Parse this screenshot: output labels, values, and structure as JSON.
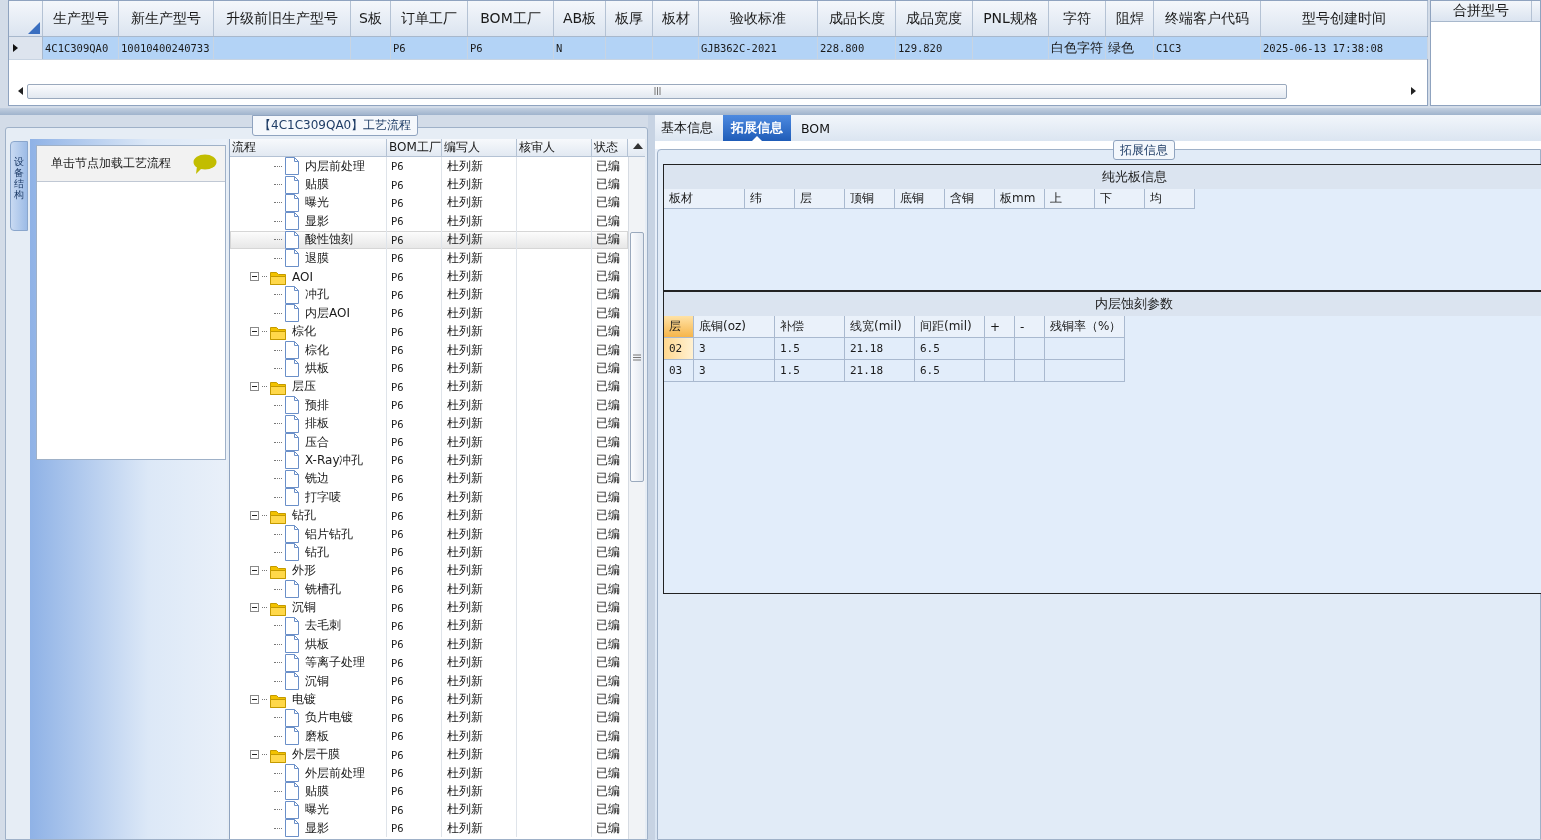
{
  "grid": {
    "columns": [
      "生产型号",
      "新生产型号",
      "升级前旧生产型号",
      "S板",
      "订单工厂",
      "BOM工厂",
      "AB板",
      "板厚",
      "板材",
      "验收标准",
      "成品长度",
      "成品宽度",
      "PNL规格",
      "字符",
      "阻焊",
      "终端客户代码",
      "型号创建时间"
    ],
    "rows": [
      {
        "selected": true,
        "cells": [
          "4C1C309QA0",
          "10010400240733",
          null,
          null,
          "P6",
          "P6",
          "N",
          null,
          null,
          "GJB362C-2021",
          "228.800",
          "129.820",
          null,
          "白色字符",
          "绿色",
          "C1C3",
          "2025-06-13 17:38:08"
        ]
      }
    ]
  },
  "merge_panel": {
    "title": "合拼型号"
  },
  "process": {
    "title": "【4C1C309QA0】工艺流程",
    "side_tab": "设备结构",
    "hint": "单击节点加载工艺流程",
    "columns": [
      "流程",
      "BOM工厂",
      "编写人",
      "核审人",
      "状态"
    ],
    "nodes": [
      {
        "kind": "doc",
        "label": "内层前处理",
        "bom": "P6",
        "writer": "杜列新",
        "status": "已编",
        "selected": false
      },
      {
        "kind": "doc",
        "label": "贴膜",
        "bom": "P6",
        "writer": "杜列新",
        "status": "已编",
        "selected": false
      },
      {
        "kind": "doc",
        "label": "曝光",
        "bom": "P6",
        "writer": "杜列新",
        "status": "已编",
        "selected": false
      },
      {
        "kind": "doc",
        "label": "显影",
        "bom": "P6",
        "writer": "杜列新",
        "status": "已编",
        "selected": false
      },
      {
        "kind": "doc",
        "label": "酸性蚀刻",
        "bom": "P6",
        "writer": "杜列新",
        "status": "已编",
        "selected": true
      },
      {
        "kind": "doc",
        "label": "退膜",
        "bom": "P6",
        "writer": "杜列新",
        "status": "已编",
        "selected": false
      },
      {
        "kind": "folder",
        "label": "AOI",
        "bom": "P6",
        "writer": "杜列新",
        "status": "已编",
        "selected": false,
        "expanded": true,
        "children": [
          {
            "kind": "doc",
            "label": "冲孔",
            "bom": "P6",
            "writer": "杜列新",
            "status": "已编",
            "selected": false
          },
          {
            "kind": "doc",
            "label": "内层AOI",
            "bom": "P6",
            "writer": "杜列新",
            "status": "已编",
            "selected": false
          }
        ]
      },
      {
        "kind": "folder",
        "label": "棕化",
        "bom": "P6",
        "writer": "杜列新",
        "status": "已编",
        "selected": false,
        "expanded": true,
        "children": [
          {
            "kind": "doc",
            "label": "棕化",
            "bom": "P6",
            "writer": "杜列新",
            "status": "已编",
            "selected": false
          },
          {
            "kind": "doc",
            "label": "烘板",
            "bom": "P6",
            "writer": "杜列新",
            "status": "已编",
            "selected": false
          }
        ]
      },
      {
        "kind": "folder",
        "label": "层压",
        "bom": "P6",
        "writer": "杜列新",
        "status": "已编",
        "selected": false,
        "expanded": true,
        "children": [
          {
            "kind": "doc",
            "label": "预排",
            "bom": "P6",
            "writer": "杜列新",
            "status": "已编",
            "selected": false
          },
          {
            "kind": "doc",
            "label": "排板",
            "bom": "P6",
            "writer": "杜列新",
            "status": "已编",
            "selected": false
          },
          {
            "kind": "doc",
            "label": "压合",
            "bom": "P6",
            "writer": "杜列新",
            "status": "已编",
            "selected": false
          },
          {
            "kind": "doc",
            "label": "X-Ray冲孔",
            "bom": "P6",
            "writer": "杜列新",
            "status": "已编",
            "selected": false
          },
          {
            "kind": "doc",
            "label": "铣边",
            "bom": "P6",
            "writer": "杜列新",
            "status": "已编",
            "selected": false
          },
          {
            "kind": "doc",
            "label": "打字唛",
            "bom": "P6",
            "writer": "杜列新",
            "status": "已编",
            "selected": false
          }
        ]
      },
      {
        "kind": "folder",
        "label": "钻孔",
        "bom": "P6",
        "writer": "杜列新",
        "status": "已编",
        "selected": false,
        "expanded": true,
        "children": [
          {
            "kind": "doc",
            "label": "铝片钻孔",
            "bom": "P6",
            "writer": "杜列新",
            "status": "已编",
            "selected": false
          },
          {
            "kind": "doc",
            "label": "钻孔",
            "bom": "P6",
            "writer": "杜列新",
            "status": "已编",
            "selected": false
          }
        ]
      },
      {
        "kind": "folder",
        "label": "外形",
        "bom": "P6",
        "writer": "杜列新",
        "status": "已编",
        "selected": false,
        "expanded": true,
        "children": [
          {
            "kind": "doc",
            "label": "铣槽孔",
            "bom": "P6",
            "writer": "杜列新",
            "status": "已编",
            "selected": false
          }
        ]
      },
      {
        "kind": "folder",
        "label": "沉铜",
        "bom": "P6",
        "writer": "杜列新",
        "status": "已编",
        "selected": false,
        "expanded": true,
        "children": [
          {
            "kind": "doc",
            "label": "去毛刺",
            "bom": "P6",
            "writer": "杜列新",
            "status": "已编",
            "selected": false
          },
          {
            "kind": "doc",
            "label": "烘板",
            "bom": "P6",
            "writer": "杜列新",
            "status": "已编",
            "selected": false
          },
          {
            "kind": "doc",
            "label": "等离子处理",
            "bom": "P6",
            "writer": "杜列新",
            "status": "已编",
            "selected": false
          },
          {
            "kind": "doc",
            "label": "沉铜",
            "bom": "P6",
            "writer": "杜列新",
            "status": "已编",
            "selected": false
          }
        ]
      },
      {
        "kind": "folder",
        "label": "电镀",
        "bom": "P6",
        "writer": "杜列新",
        "status": "已编",
        "selected": false,
        "expanded": true,
        "children": [
          {
            "kind": "doc",
            "label": "负片电镀",
            "bom": "P6",
            "writer": "杜列新",
            "status": "已编",
            "selected": false
          },
          {
            "kind": "doc",
            "label": "磨板",
            "bom": "P6",
            "writer": "杜列新",
            "status": "已编",
            "selected": false
          }
        ]
      },
      {
        "kind": "folder",
        "label": "外层干膜",
        "bom": "P6",
        "writer": "杜列新",
        "status": "已编",
        "selected": false,
        "expanded": true,
        "children": [
          {
            "kind": "doc",
            "label": "外层前处理",
            "bom": "P6",
            "writer": "杜列新",
            "status": "已编",
            "selected": false
          },
          {
            "kind": "doc",
            "label": "贴膜",
            "bom": "P6",
            "writer": "杜列新",
            "status": "已编",
            "selected": false
          },
          {
            "kind": "doc",
            "label": "曝光",
            "bom": "P6",
            "writer": "杜列新",
            "status": "已编",
            "selected": false
          },
          {
            "kind": "doc",
            "label": "显影",
            "bom": "P6",
            "writer": "杜列新",
            "status": "已编",
            "selected": false
          }
        ]
      }
    ]
  },
  "detail": {
    "tabs": [
      {
        "label": "基本信息",
        "selected": false
      },
      {
        "label": "拓展信息",
        "selected": true
      },
      {
        "label": "BOM",
        "selected": false
      }
    ],
    "group_title": "拓展信息",
    "bare_board": {
      "title": "纯光板信息",
      "columns": [
        "板材",
        "纬",
        "层",
        "顶铜",
        "底铜",
        "含铜",
        "板mm",
        "上",
        "下",
        "均"
      ]
    },
    "etch": {
      "title": "内层蚀刻参数",
      "columns": [
        "层",
        "底铜(oz)",
        "补偿",
        "线宽(mil)",
        "间距(mil)",
        "+",
        "-",
        "残铜率（%）"
      ],
      "rows": [
        {
          "selected": true,
          "cells": [
            "02",
            "3",
            "1.5",
            "21.18",
            "6.5",
            null,
            null,
            null
          ]
        },
        {
          "selected": false,
          "cells": [
            "03",
            "3",
            "1.5",
            "21.18",
            "6.5",
            null,
            null,
            null
          ]
        }
      ]
    }
  }
}
